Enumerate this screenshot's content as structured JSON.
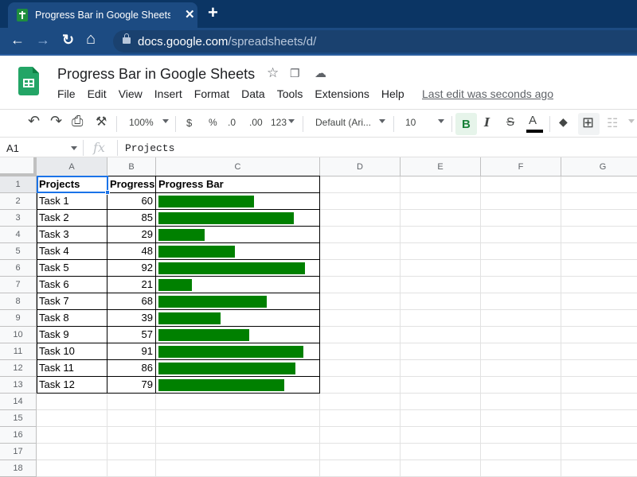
{
  "browser": {
    "tab_title": "Progress Bar in Google Sheets - Google Sheets",
    "url_host": "docs.google.com",
    "url_path": "/spreadsheets/d/",
    "icons": {
      "favicon": "sheets-favicon",
      "close": "✕",
      "new_tab": "+",
      "back": "←",
      "forward": "→",
      "reload": "↻",
      "home": "⌂"
    }
  },
  "doc": {
    "title": "Progress Bar in Google Sheets",
    "star_icon": "☆",
    "move_icon": "❐",
    "cloud_icon": "☁",
    "menu": [
      "File",
      "Edit",
      "View",
      "Insert",
      "Format",
      "Data",
      "Tools",
      "Extensions",
      "Help"
    ],
    "last_edit": "Last edit was seconds ago"
  },
  "toolbar": {
    "undo": "↶",
    "redo": "↷",
    "print": "⎙",
    "paint_format": "⚒",
    "zoom": "100%",
    "currency": "$",
    "percent": "%",
    "decrease_decimal": ".0",
    "increase_decimal": ".00",
    "more_formats": "123",
    "font": "Default (Ari...",
    "font_size": "10",
    "bold": "B",
    "italic": "I",
    "strikethrough": "S",
    "text_color": "A",
    "fill_color": "◆",
    "borders": "⊞",
    "merge": "☷"
  },
  "formula_bar": {
    "cell_ref": "A1",
    "fx": "fx",
    "content": "Projects"
  },
  "sheet": {
    "columns": [
      "A",
      "B",
      "C",
      "D",
      "E",
      "F",
      "G"
    ],
    "rows": [
      "1",
      "2",
      "3",
      "4",
      "5",
      "6",
      "7",
      "8",
      "9",
      "10",
      "11",
      "12",
      "13",
      "14",
      "15",
      "16",
      "17",
      "18"
    ],
    "headers": [
      "Projects",
      "Progress",
      "Progress Bar"
    ],
    "bar_color": "#008000",
    "selected_cell": "A1",
    "data": [
      {
        "task": "Task 1",
        "progress": 60
      },
      {
        "task": "Task 2",
        "progress": 85
      },
      {
        "task": "Task 3",
        "progress": 29
      },
      {
        "task": "Task 4",
        "progress": 48
      },
      {
        "task": "Task 5",
        "progress": 92
      },
      {
        "task": "Task 6",
        "progress": 21
      },
      {
        "task": "Task 7",
        "progress": 68
      },
      {
        "task": "Task 8",
        "progress": 39
      },
      {
        "task": "Task 9",
        "progress": 57
      },
      {
        "task": "Task 10",
        "progress": 91
      },
      {
        "task": "Task 11",
        "progress": 86
      },
      {
        "task": "Task 12",
        "progress": 79
      }
    ]
  }
}
